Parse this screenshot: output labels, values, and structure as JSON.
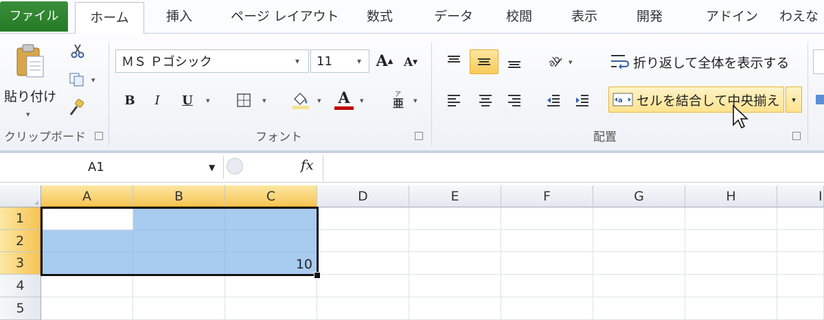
{
  "tabs": {
    "file": "ファイル",
    "home": "ホーム",
    "insert": "挿入",
    "page_layout": "ページ レイアウト",
    "formulas": "数式",
    "data": "データ",
    "review": "校閲",
    "view": "表示",
    "developer": "開発",
    "addins": "アドイン",
    "extra": "わえな"
  },
  "clipboard": {
    "paste_label": "貼り付け",
    "group_label": "クリップボード"
  },
  "font": {
    "font_name": "ＭＳ Ｐゴシック",
    "font_size": "11",
    "bold": "B",
    "italic": "I",
    "underline": "U",
    "color_letter": "A",
    "group_label": "フォント"
  },
  "alignment": {
    "wrap_text": "折り返して全体を表示する",
    "merge_center": "セルを結合して中央揃え",
    "group_label": "配置"
  },
  "formula_bar": {
    "name_box": "A1",
    "fx": "fx",
    "formula": ""
  },
  "sheet": {
    "columns": [
      "A",
      "B",
      "C",
      "D",
      "E",
      "F",
      "G",
      "H",
      "I"
    ],
    "rows": [
      "1",
      "2",
      "3",
      "4",
      "5"
    ],
    "c3_value": "10"
  }
}
